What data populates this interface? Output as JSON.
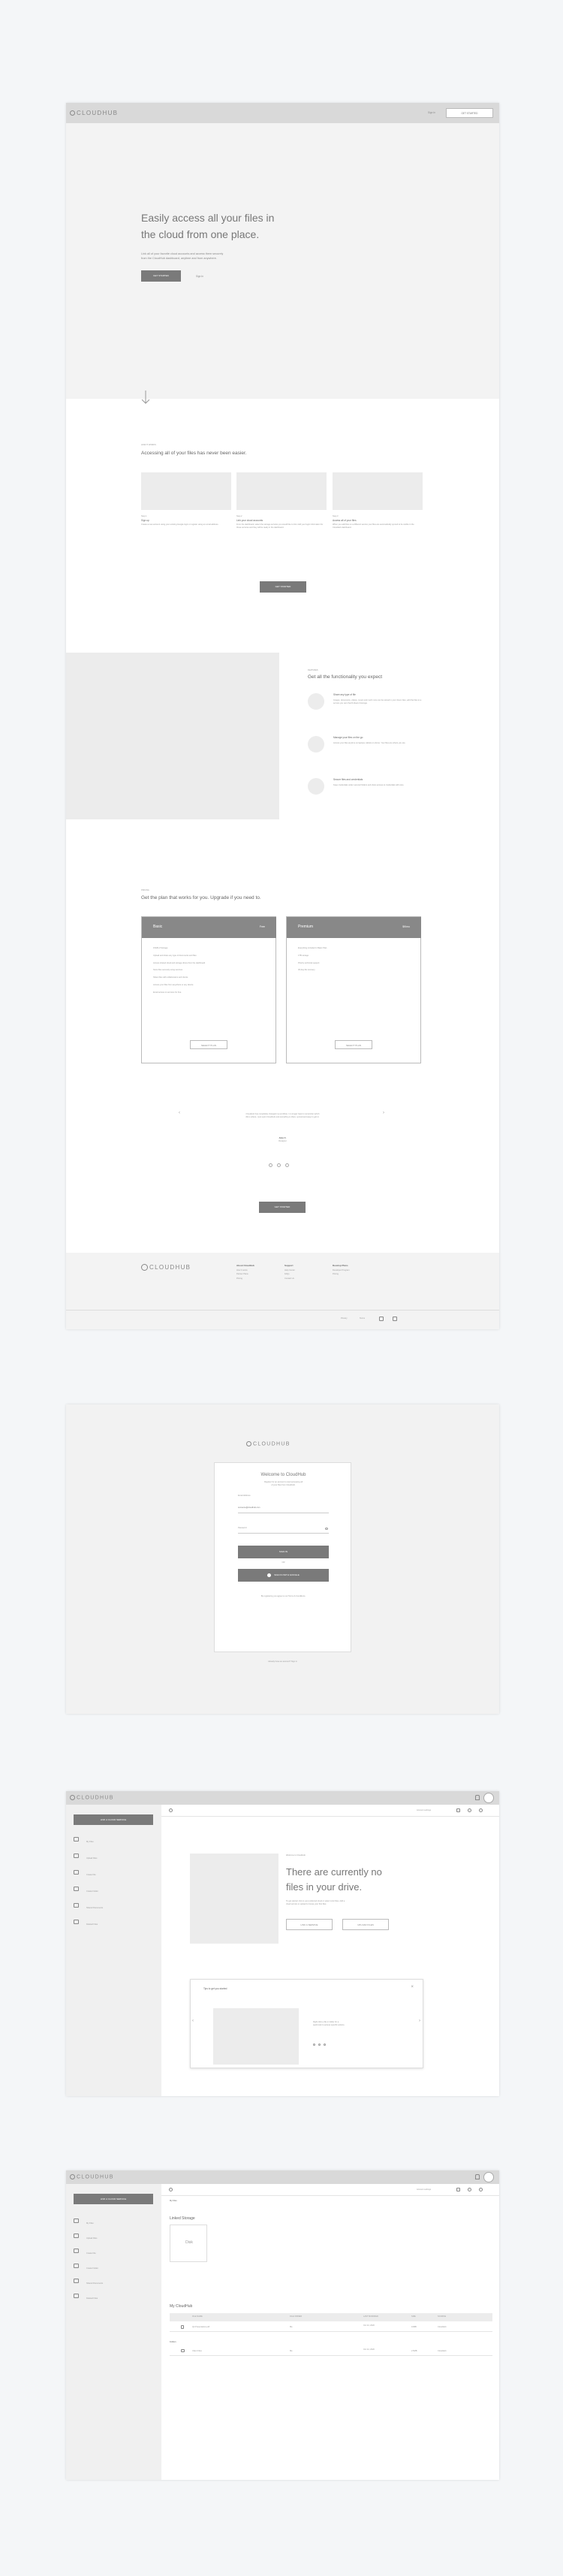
{
  "brand": {
    "name": "CLOUDHUB"
  },
  "landing": {
    "nav": {
      "sign_in": "Sign In",
      "get_started": "GET STARTED"
    },
    "hero": {
      "title_l1": "Easily access all your files in",
      "title_l2": "the cloud from one place.",
      "desc_l1": "Link all of your favorite cloud accounts and access them securely",
      "desc_l2": "from the CloudHub dashboard, anytime and from anywhere.",
      "cta": "GET STARTED",
      "secondary": "Sign In"
    },
    "how": {
      "eyebrow": "HOW IT WORKS",
      "heading": "Accessing all of your files has never been easier.",
      "steps": [
        {
          "step": "Step 1",
          "title": "Sign up",
          "desc": "Create a new account using your existing Google login or register using an email address."
        },
        {
          "step": "Step 2",
          "title": "Link your cloud accounts",
          "desc": "From the dashboard, select the storage services you would like to link. Add your login information for those services and they will be ready in the dashboard."
        },
        {
          "step": "Step 3",
          "title": "Access all of your files",
          "desc": "When you add files on a different service your files are automatically synced to be visible in the CloudHub dashboard."
        }
      ],
      "cta": "GET STARTED"
    },
    "features": {
      "eyebrow": "FEATURES",
      "heading": "Get all the functionality you expect",
      "items": [
        {
          "title": "Share any type of file",
          "desc": "Images, documents, videos, music and much more can be stored in your cloud. Also, add the files to a service you own that fit ideal of storage."
        },
        {
          "title": "Manage your files on the go",
          "desc": "Access your files anytime on laptops, tablets or phone. Your files are where you are."
        },
        {
          "title": "Secure files and credentials",
          "desc": "Keep credentials under secured folders and share access to credentials with care."
        }
      ]
    },
    "pricing": {
      "eyebrow": "PRICING",
      "heading": "Get the plan that works for you. Upgrade if you need to.",
      "plans": [
        {
          "name": "Basic",
          "price": "Free",
          "features": [
            "15GB of Storage",
            "Upload and share any type of documents and files",
            "Access shared cloud and storage drives from the dashboard",
            "Store files securely using services",
            "Share files with collaborators and clients",
            "Access your files from anywhere or any device",
            "Email access to services for free"
          ],
          "cta": "SELECT PLAN"
        },
        {
          "name": "Premium",
          "price": "$9/mo",
          "features": [
            "Everything included in Basic Plan",
            "1TB storage",
            "Priority technical support",
            "30-day file recovery"
          ],
          "cta": "SELECT PLAN"
        }
      ]
    },
    "testimonial": {
      "quote_l1": "CloudHub has completely changed my workflow. I no longer have to remember which",
      "quote_l2": "file is where. I just open CloudHub and everything is there, synced and easy to get to.",
      "author": "Jane C.",
      "role": "Designer"
    },
    "bottom_cta": "GET STARTED",
    "footer": {
      "cols": [
        {
          "title": "About CloudHub",
          "links": [
            "How it works",
            "Partner Plans",
            "Pricing"
          ]
        },
        {
          "title": "Support",
          "links": [
            "Help Center",
            "FAQs",
            "Contact Us"
          ]
        },
        {
          "title": "Develop Plans",
          "links": [
            "Developer Program",
            "Pricing"
          ]
        }
      ],
      "legal": [
        "Privacy",
        "Terms"
      ]
    }
  },
  "signin": {
    "title": "Welcome to CloudHub",
    "subtitle_l1": "Register for an account to start accessing all",
    "subtitle_l2": "of your files from CloudHub.",
    "label": "Email Address",
    "email_value": "someone@cloudhub.com",
    "password_placeholder": "Password",
    "signin_button": "SIGN IN",
    "or": "OR",
    "google_button": "SIGN IN WITH GOOGLE",
    "terms": "By registering you agree to our Terms & Conditions.",
    "forgot": "Already have an account? Sign in"
  },
  "dashboard": {
    "add_button": "LINK A CLOUD SERVICE",
    "sidebar": [
      "My Files",
      "Upload Files",
      "Create File",
      "Create Folder",
      "Shared Documents",
      "Deleted Files"
    ],
    "search_placeholder": "Search",
    "account_label": "Account settings",
    "empty": {
      "eyebrow": "Welcome to CloudHub",
      "title_l1": "There are currently no",
      "title_l2": "files in your drive.",
      "desc_l1": "To get started, link to your preferred cloud or select Link Files. Add a",
      "desc_l2": "cloud service or upload to house your first files.",
      "btn1": "LINK A SERVICE",
      "btn2": "UPLOAD FILES"
    },
    "tips": {
      "title": "Tips to get you started",
      "text_l1": "Right click a file or folder for a",
      "text_l2": "quick look to access specific actions."
    }
  },
  "files": {
    "crumb": "My Files",
    "linked_title": "Linked Storage",
    "service_label": "Disk",
    "mycloud_title": "My CloudHub",
    "columns": [
      "FILE NAME",
      "FILE OWNER",
      "LAST MODIFIED",
      "SIZE",
      "SOURCE"
    ],
    "rows": [
      {
        "name": "Q4 Presentation.pdf",
        "owner": "Me",
        "modified": "Oct 24, 2020",
        "size": "10MB",
        "source": "CloudHub"
      }
    ],
    "folders_label": "Folders",
    "folder_rows": [
      {
        "name": "Client Files",
        "owner": "Me",
        "modified": "Oct 24, 2020",
        "size": "2.5MB",
        "source": "CloudHub"
      }
    ]
  }
}
